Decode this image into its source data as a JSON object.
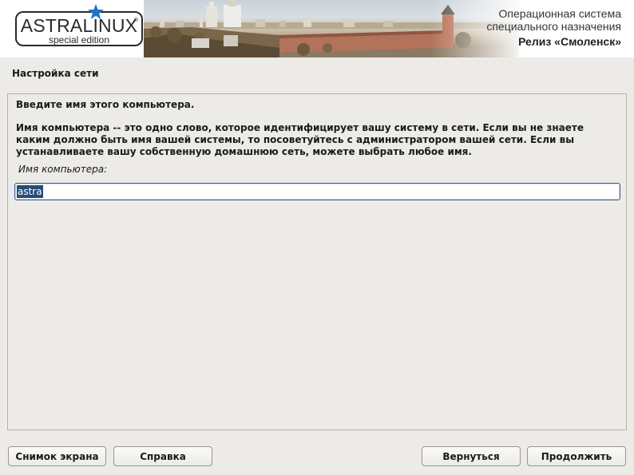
{
  "banner": {
    "logo_main": "ASTRALINUX",
    "logo_reg": "®",
    "logo_sub": "special edition",
    "tagline_line1": "Операционная система",
    "tagline_line2": "специального назначения",
    "release": "Релиз «Смоленск»",
    "photo_icon": "landscape-photo",
    "star_icon": "star-icon"
  },
  "page": {
    "title": "Настройка сети"
  },
  "form": {
    "prompt": "Введите имя этого компьютера.",
    "description": "Имя компьютера -- это одно слово, которое идентифицирует вашу систему в сети. Если вы не знаете каким должно быть имя вашей системы, то посоветуйтесь с администратором вашей сети. Если вы устанавливаете вашу собственную домашнюю сеть, можете выбрать любое имя.",
    "field_label": "Имя компьютера:",
    "hostname_value": "astra"
  },
  "buttons": {
    "screenshot": "Снимок экрана",
    "help": "Справка",
    "back": "Вернуться",
    "continue": "Продолжить"
  },
  "colors": {
    "accent": "#244d78",
    "star": "#1f74c7",
    "background": "#edebe7"
  }
}
